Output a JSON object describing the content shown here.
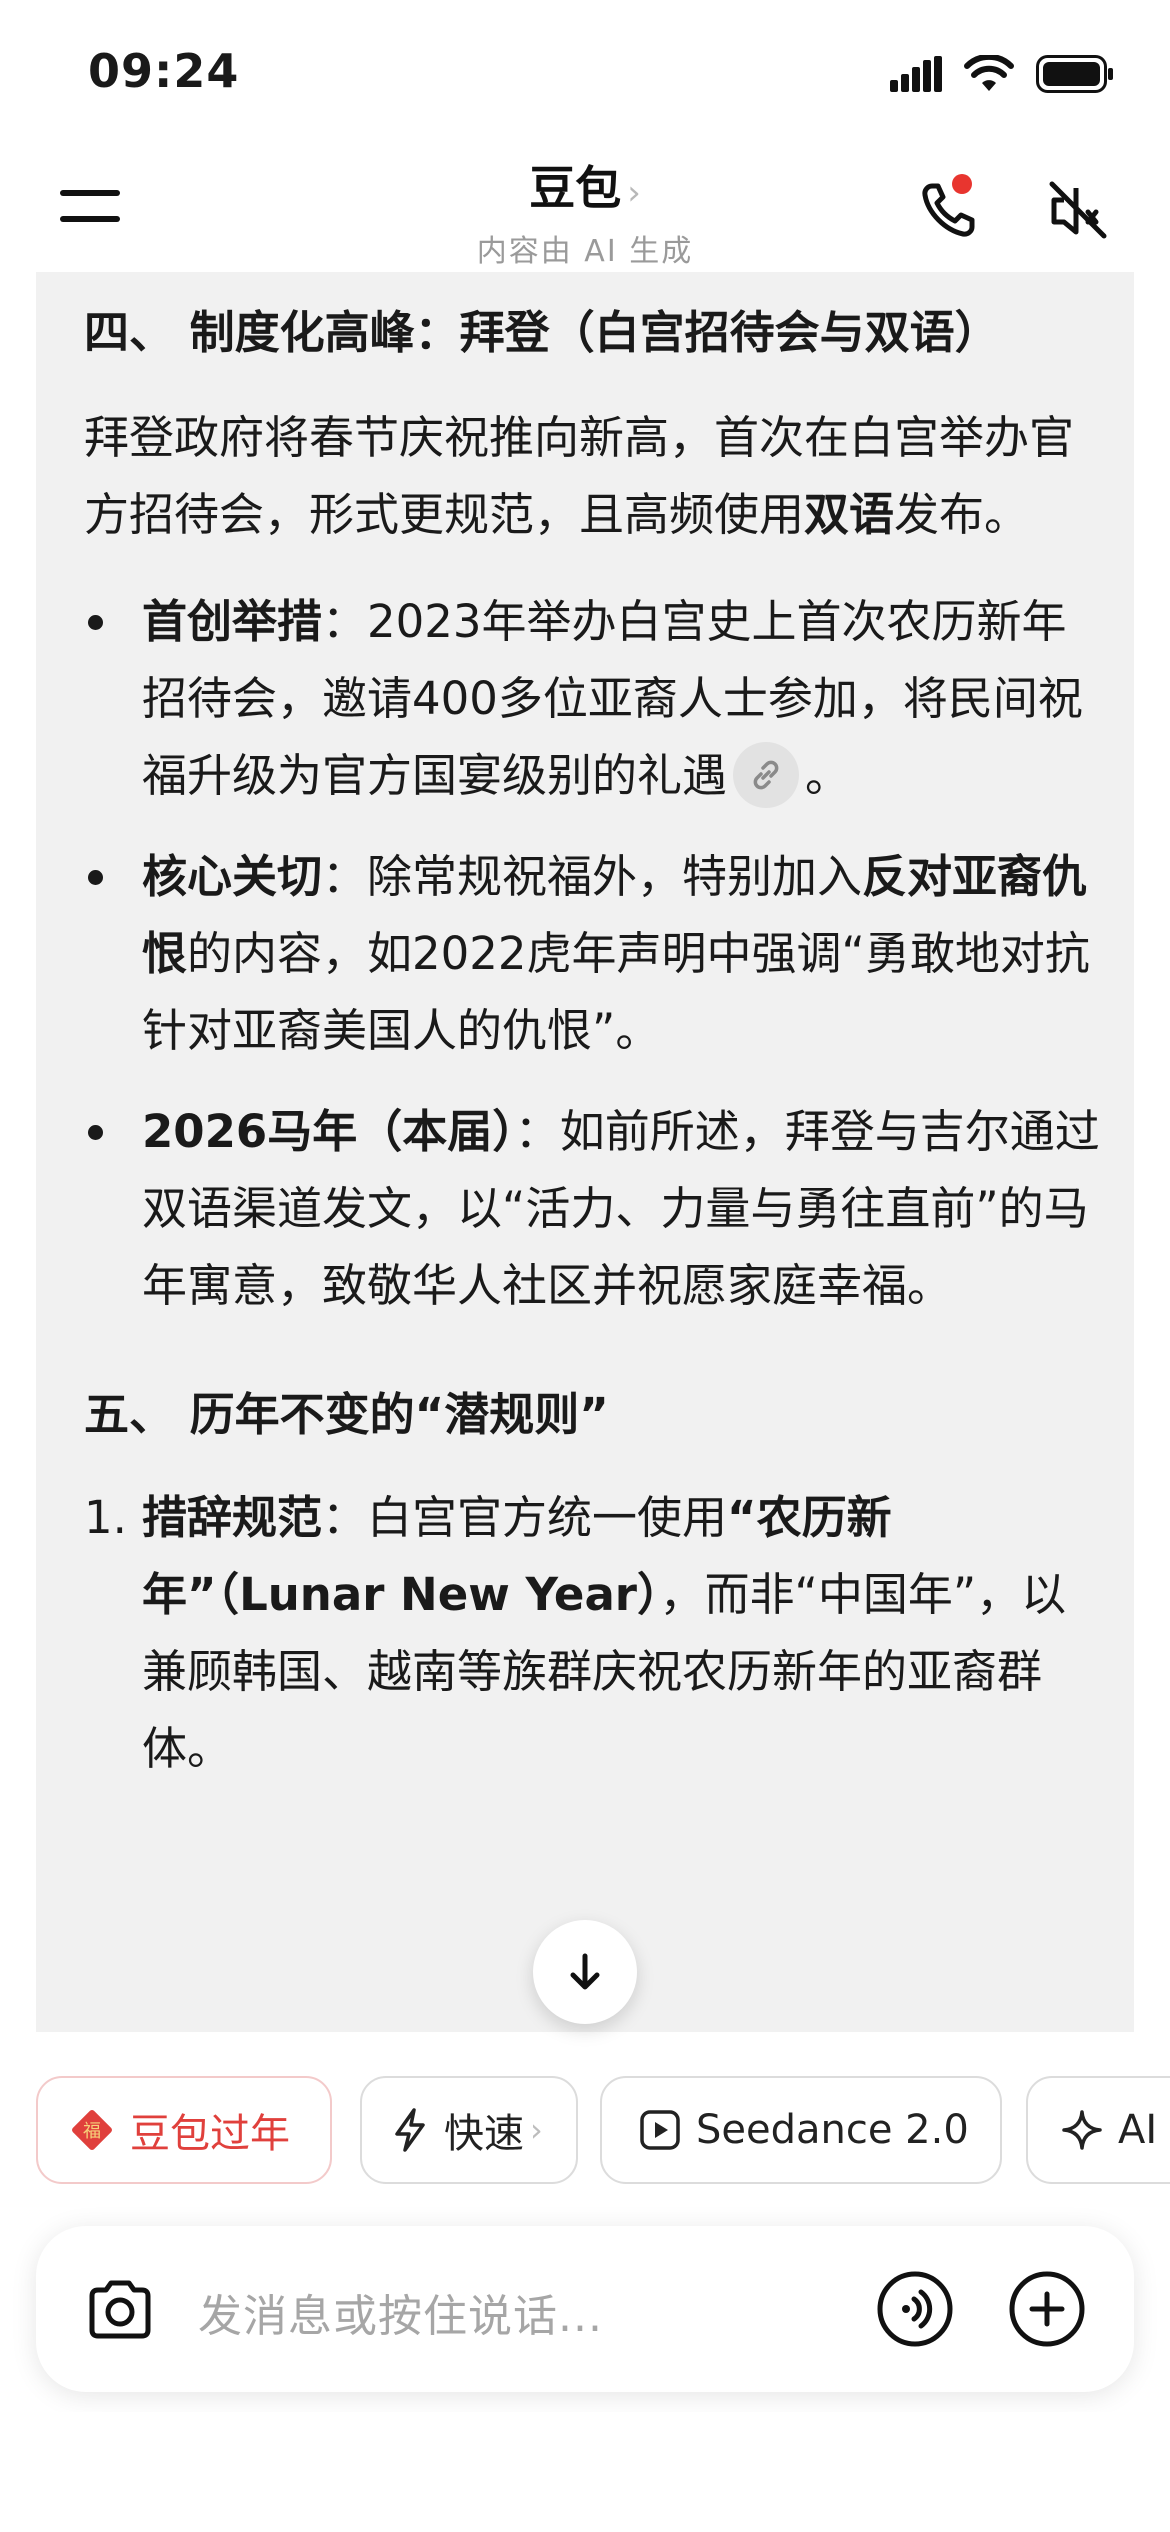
{
  "status_bar": {
    "time": "09:24"
  },
  "header": {
    "title": "豆包",
    "title_chevron": "›",
    "subtitle": "内容由 AI 生成"
  },
  "message": {
    "section4": {
      "heading": "四、 制度化高峰：拜登（白宫招待会与双语）",
      "intro_pre": "拜登政府将春节庆祝推向新高，首次在白宫举办官方招待会，形式更规范，且高频使用",
      "intro_bold": "双语",
      "intro_post": "发布。",
      "bullets": [
        {
          "label": "首创举措",
          "text": "：2023年举办白宫史上首次农历新年招待会，邀请400多位亚裔人士参加，将民间祝福升级为官方国宴级别的礼遇",
          "tail": "。"
        },
        {
          "label": "核心关切",
          "text_pre": "：除常规祝福外，特别加入",
          "text_bold": "反对亚裔仇恨",
          "text_post": "的内容，如2022虎年声明中强调“勇敢地对抗针对亚裔美国人的仇恨”。"
        },
        {
          "label": "2026马年（本届）",
          "text": "：如前所述，拜登与吉尔通过双语渠道发文，以“活力、力量与勇往直前”的马年寓意，致敬华人社区并祝愿家庭幸福。"
        }
      ]
    },
    "section5": {
      "heading": "五、 历年不变的“潜规则”",
      "items": [
        {
          "num": "1.",
          "label": "措辞规范",
          "text_pre": "：白宫官方统一使用",
          "text_bold": "“农历新年”（Lunar New Year）",
          "text_post": "，而非“中国年”，以兼顾韩国、越南等族群庆祝农历新年的亚裔群体。"
        }
      ]
    }
  },
  "chips": [
    {
      "label": "豆包过年",
      "icon": "fu-icon",
      "color": "#e0403c"
    },
    {
      "label": "快速",
      "icon": "lightning-icon",
      "chevron": "›"
    },
    {
      "label": "Seedance 2.0",
      "icon": "video-play-icon"
    },
    {
      "label": "AI",
      "icon": "sparkle-icon"
    }
  ],
  "input": {
    "placeholder": "发消息或按住说话..."
  }
}
